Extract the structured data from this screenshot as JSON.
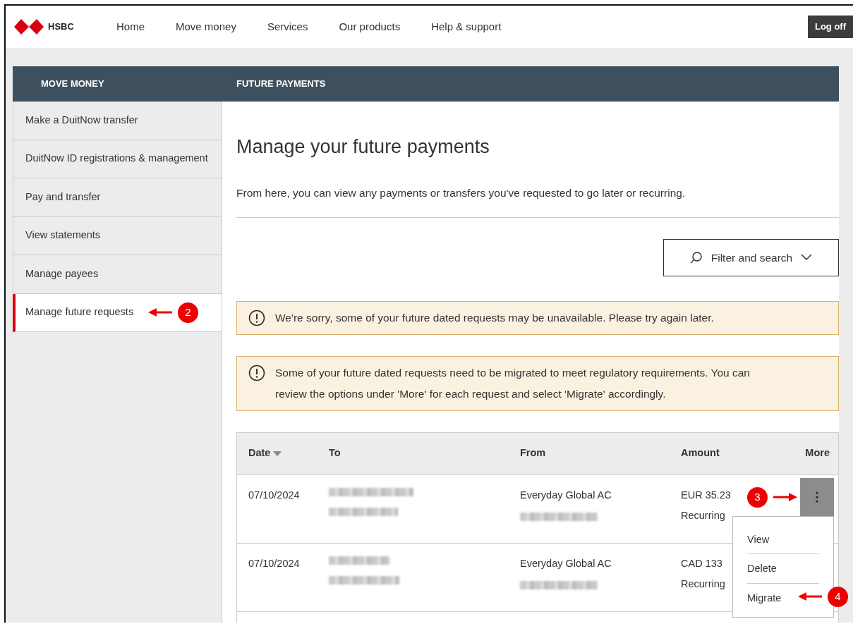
{
  "brand": "HSBC",
  "nav": [
    {
      "label": "Home"
    },
    {
      "label": "Move money"
    },
    {
      "label": "Services"
    },
    {
      "label": "Our products"
    },
    {
      "label": "Help & support"
    }
  ],
  "logoff": "Log off",
  "sidebar": {
    "title": "MOVE MONEY",
    "items": [
      {
        "label": "Make a DuitNow transfer",
        "selected": false
      },
      {
        "label": "DuitNow ID registrations & management",
        "selected": false
      },
      {
        "label": "Pay and transfer",
        "selected": false
      },
      {
        "label": "View statements",
        "selected": false
      },
      {
        "label": "Manage payees",
        "selected": false
      },
      {
        "label": "Manage future requests",
        "selected": true,
        "step": "2"
      }
    ]
  },
  "page": {
    "section": "FUTURE PAYMENTS",
    "heading": "Manage your future payments",
    "intro": "From here, you can view any payments or transfers you've requested to go later or recurring.",
    "filter_button": "Filter and search",
    "alerts": [
      {
        "lines": [
          "We're sorry, some of your future dated requests may be unavailable. Please try again later."
        ]
      },
      {
        "lines": [
          "Some of your future dated requests need to be migrated to meet regulatory requirements. You can",
          "review the options under 'More' for each request and select 'Migrate' accordingly."
        ]
      }
    ],
    "table": {
      "columns": [
        {
          "label": "Date",
          "sorted": true
        },
        {
          "label": "To",
          "sorted": false
        },
        {
          "label": "From",
          "sorted": false
        },
        {
          "label": "Amount",
          "sorted": false
        },
        {
          "label": "More",
          "sorted": false
        }
      ],
      "rows": [
        {
          "date": "07/10/2024",
          "from": "Everyday Global AC",
          "amount": "EUR 35.23",
          "frequency": "Recurring",
          "menu_open": true,
          "step": "3"
        },
        {
          "date": "07/10/2024",
          "from": "Everyday Global AC",
          "amount": "CAD 133",
          "frequency": "Recurring",
          "menu_open": false
        }
      ]
    },
    "menu": {
      "items": [
        {
          "label": "View"
        },
        {
          "label": "Delete"
        },
        {
          "label": "Migrate",
          "step": "4"
        }
      ]
    }
  }
}
